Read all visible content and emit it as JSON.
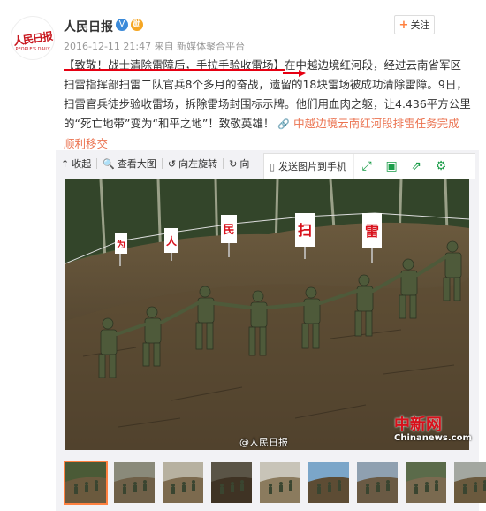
{
  "post": {
    "username": "人民日报",
    "verified_badge": "V",
    "medal_badge": "勋",
    "follow_label": "关注",
    "follow_plus": "+",
    "time": "2016-12-11 21:47",
    "source_prefix": "来自",
    "source": "新媒体聚合平台",
    "text_part1": "【致敬！战士清除雷障后，手拉手验收雷场】",
    "text_part2": "在中越边境红河段，经过云南省军区扫雷指挥部扫雷二队官兵8个多月的奋战，遗留的18块雷场被成功清除雷障。9日，扫雷官兵徒步验收雷场，拆除雷场封围标示牌。他们用血肉之躯，让4.436平方公里的“死亡地带”变为“和平之地”！致敬英雄！",
    "link_text": "中越边境云南红河段排雷任务完成 顺利移交",
    "link_icon": "🔗",
    "avatar_logo": "人民日报",
    "avatar_sub": "PEOPLE'S DAILY"
  },
  "toolbar": {
    "collapse_label": "收起",
    "view_large_label": "查看大图",
    "rotate_left_label": "向左旋转",
    "rotate_right_label": "向",
    "send_to_phone_label": "发送图片到手机"
  },
  "photo": {
    "signs": [
      "为",
      "人",
      "民",
      "扫",
      "雷"
    ],
    "watermark_user": "@人民日报",
    "watermark_cn": "中新网",
    "watermark_cn_sub": "Chinanews.com"
  },
  "thumbnails": {
    "count": 9,
    "active_index": 0
  },
  "colors": {
    "accent_orange": "#ff8140",
    "link": "#eb7350",
    "sign_red": "#d8101b",
    "green_icon": "#1c9d4a"
  }
}
